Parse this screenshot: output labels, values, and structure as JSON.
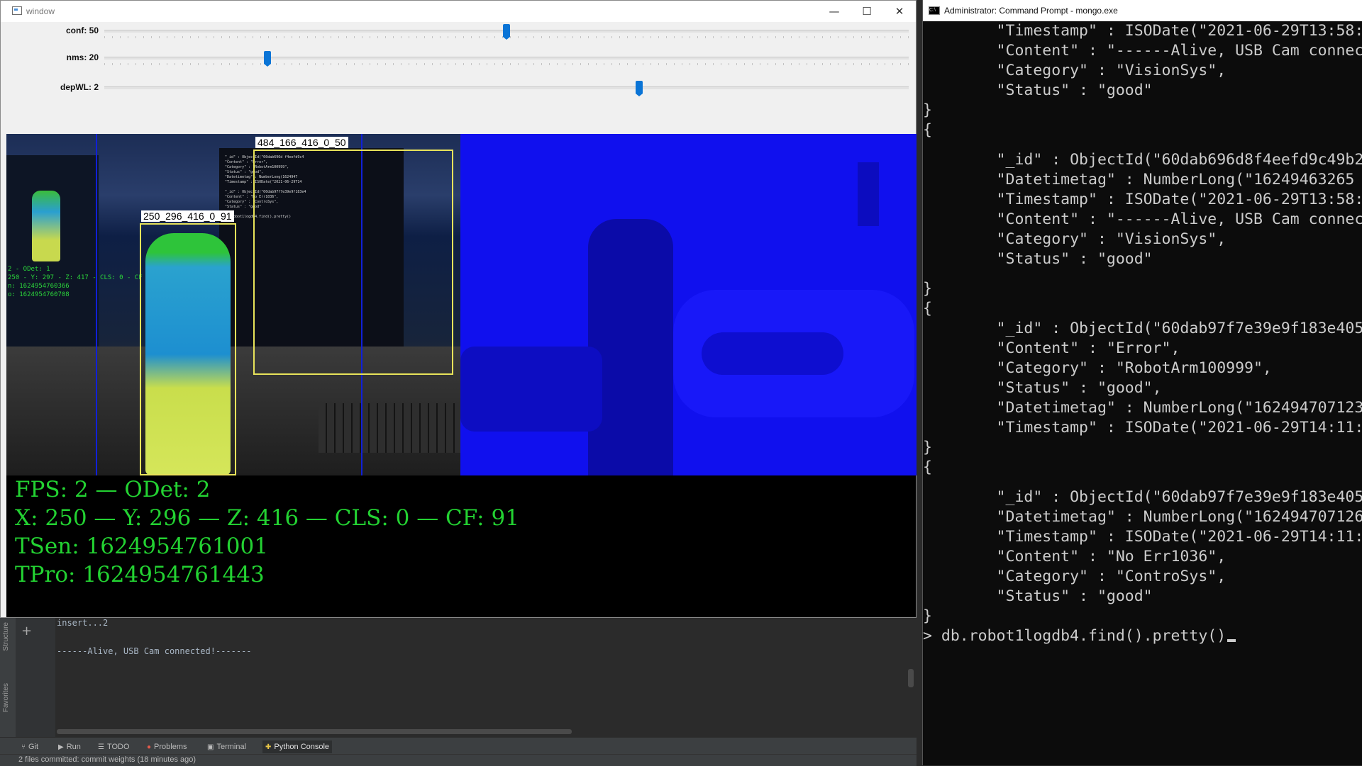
{
  "window": {
    "title": "window",
    "minimize": "—",
    "maximize": "☐",
    "close": "✕",
    "trackbars": [
      {
        "label": "conf: 50",
        "value": 50
      },
      {
        "label": "nms: 20",
        "value": 20
      },
      {
        "label": "depWL: 2",
        "value": 2
      }
    ],
    "detections": [
      {
        "label": "484_166_416_0_50"
      },
      {
        "label": "250_296_416_0_91"
      }
    ],
    "camera_overlay_text": "2 - ODet: 1\n250 - Y: 297 - Z: 417 - CLS: 0 - CF\nn: 1624954760366\no: 1624954760708",
    "screen_text": "\"_id\" : ObjectId(\"60dab696d f4eefd9c4\n\"Content\" : \"Error\",\n\"Category\" : \"RobotArm100999\",\n\"Status\" : \"good\",\n\"Datetimetag\" : NumberLong(1624947\n\"Timestamp\" : ISODate(\"2021-06-29T14\n\n\"_id\" : ObjectId(\"60dab97f7e39e9f183e4\n\"Content\" : \"No Err1036\",\n\"Category\" : \"ControSys\",\n\"Status\" : \"good\"\n\ndb.robot1logdb4.find().pretty()",
    "stats": [
      "FPS: 2 — ODet: 2",
      "X: 250 — Y: 296 — Z: 416 — CLS: 0 — CF: 91",
      "TSen: 1624954761001",
      "TPro: 1624954761443"
    ]
  },
  "ide": {
    "console_lines": [
      "insert...2",
      "------Alive, USB Cam connected!-------"
    ],
    "side_tabs": [
      "Structure",
      "Favorites"
    ],
    "toolbar": [
      {
        "label": "Git",
        "icon": "git-icon",
        "glyph": "⑂"
      },
      {
        "label": "Run",
        "icon": "run-icon",
        "glyph": "▶"
      },
      {
        "label": "TODO",
        "icon": "todo-icon",
        "glyph": "☰"
      },
      {
        "label": "Problems",
        "icon": "problems-icon",
        "glyph": "●"
      },
      {
        "label": "Terminal",
        "icon": "terminal-icon",
        "glyph": "▣"
      },
      {
        "label": "Python Console",
        "icon": "python-console-icon",
        "glyph": "✚"
      }
    ],
    "status": "2 files committed: commit weights (18 minutes ago)"
  },
  "cmd": {
    "title": "Administrator: Command Prompt - mongo.exe",
    "lines": [
      "        \"Timestamp\" : ISODate(\"2021-06-29T13:58:",
      "        \"Content\" : \"------Alive, USB Cam connec",
      "        \"Category\" : \"VisionSys\",",
      "        \"Status\" : \"good\"",
      "}",
      "{",
      "        \"_id\" : ObjectId(\"60dab696d8f4eefd9c49b2",
      "        \"Datetimetag\" : NumberLong(\"16249463265",
      "        \"Timestamp\" : ISODate(\"2021-06-29T13:58:",
      "        \"Content\" : \"------Alive, USB Cam connec",
      "        \"Category\" : \"VisionSys\",",
      "        \"Status\" : \"good\"",
      "}",
      "{",
      "        \"_id\" : ObjectId(\"60dab97f7e39e9f183e405",
      "        \"Content\" : \"Error\",",
      "        \"Category\" : \"RobotArm100999\",",
      "        \"Status\" : \"good\",",
      "        \"Datetimetag\" : NumberLong(\"162494707123",
      "        \"Timestamp\" : ISODate(\"2021-06-29T14:11:",
      "}",
      "{",
      "        \"_id\" : ObjectId(\"60dab97f7e39e9f183e405",
      "        \"Datetimetag\" : NumberLong(\"162494707126",
      "        \"Timestamp\" : ISODate(\"2021-06-29T14:11:",
      "        \"Content\" : \"No Err1036\",",
      "        \"Category\" : \"ControSys\",",
      "        \"Status\" : \"good\"",
      "}"
    ],
    "prompt": "> db.robot1logdb4.find().pretty()"
  }
}
